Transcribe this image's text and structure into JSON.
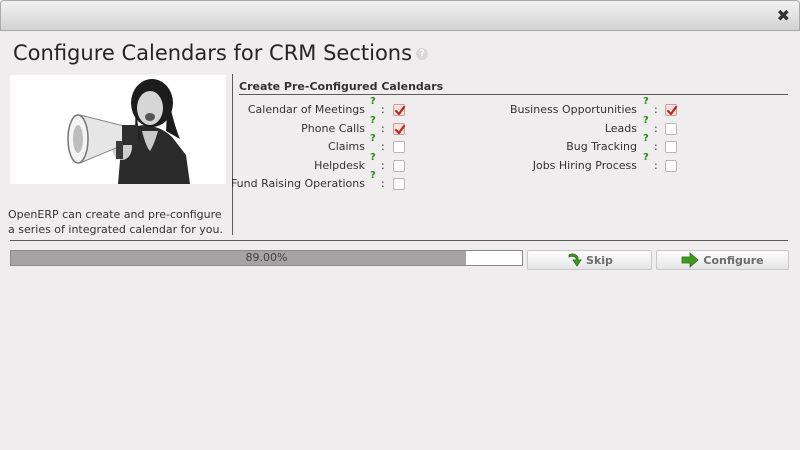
{
  "window": {
    "close_symbol": "✖",
    "close_icon": "close-icon"
  },
  "page": {
    "title": "Configure Calendars for CRM Sections",
    "title_help_symbol": "?"
  },
  "intro": {
    "text": "OpenERP can create and pre-configure a series of integrated calendar for you."
  },
  "section": {
    "header": "Create Pre-Configured Calendars"
  },
  "help_symbol": "?",
  "colon": ":",
  "fields": {
    "left": [
      {
        "label": "Calendar of Meetings",
        "checked": true
      },
      {
        "label": "Phone Calls",
        "checked": true
      },
      {
        "label": "Claims",
        "checked": false
      },
      {
        "label": "Helpdesk",
        "checked": false
      },
      {
        "label": "Fund Raising Operations",
        "checked": false
      }
    ],
    "right": [
      {
        "label": "Business Opportunities",
        "checked": true
      },
      {
        "label": "Leads",
        "checked": false
      },
      {
        "label": "Bug Tracking",
        "checked": false
      },
      {
        "label": "Jobs Hiring Process",
        "checked": false
      }
    ]
  },
  "progress": {
    "label": "89.00%",
    "fraction": 0.89
  },
  "buttons": {
    "skip": "Skip",
    "configure": "Configure"
  },
  "colors": {
    "help_green": "#2c8b1d",
    "check_red": "#c0281f",
    "progress_fill": "#a4a4a4",
    "icon_green": "#3f9a23"
  }
}
